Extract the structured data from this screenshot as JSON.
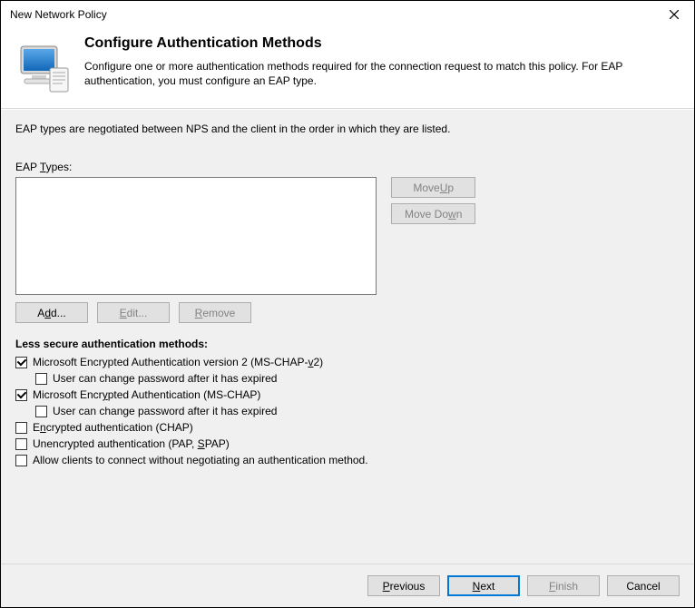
{
  "titlebar": {
    "title": "New Network Policy",
    "close_label": "Close"
  },
  "header": {
    "title": "Configure Authentication Methods",
    "description": "Configure one or more authentication methods required for the connection request to match this policy. For EAP authentication, you must configure an EAP type."
  },
  "body": {
    "negotiation_text": "EAP types are negotiated between NPS and the client in the order in which they are listed.",
    "eap_types_label": "EAP Types:",
    "eap_types_items": [],
    "buttons": {
      "move_up": "Move Up",
      "move_down": "Move Down",
      "add": "Add...",
      "edit": "Edit...",
      "remove": "Remove"
    },
    "less_secure_label": "Less secure authentication methods:",
    "checkboxes": {
      "mschap2": {
        "label": "Microsoft Encrypted Authentication version 2 (MS-CHAP-v2)",
        "checked": true
      },
      "mschap2_pwd": {
        "label": "User can change password after it has expired",
        "checked": false
      },
      "mschap": {
        "label": "Microsoft Encrypted Authentication (MS-CHAP)",
        "checked": true
      },
      "mschap_pwd": {
        "label": "User can change password after it has expired",
        "checked": false
      },
      "chap": {
        "label": "Encrypted authentication (CHAP)",
        "checked": false
      },
      "pap": {
        "label": "Unencrypted authentication (PAP, SPAP)",
        "checked": false
      },
      "allow_no_auth": {
        "label": "Allow clients to connect without negotiating an authentication method.",
        "checked": false
      }
    }
  },
  "footer": {
    "previous": "Previous",
    "next": "Next",
    "finish": "Finish",
    "cancel": "Cancel"
  }
}
